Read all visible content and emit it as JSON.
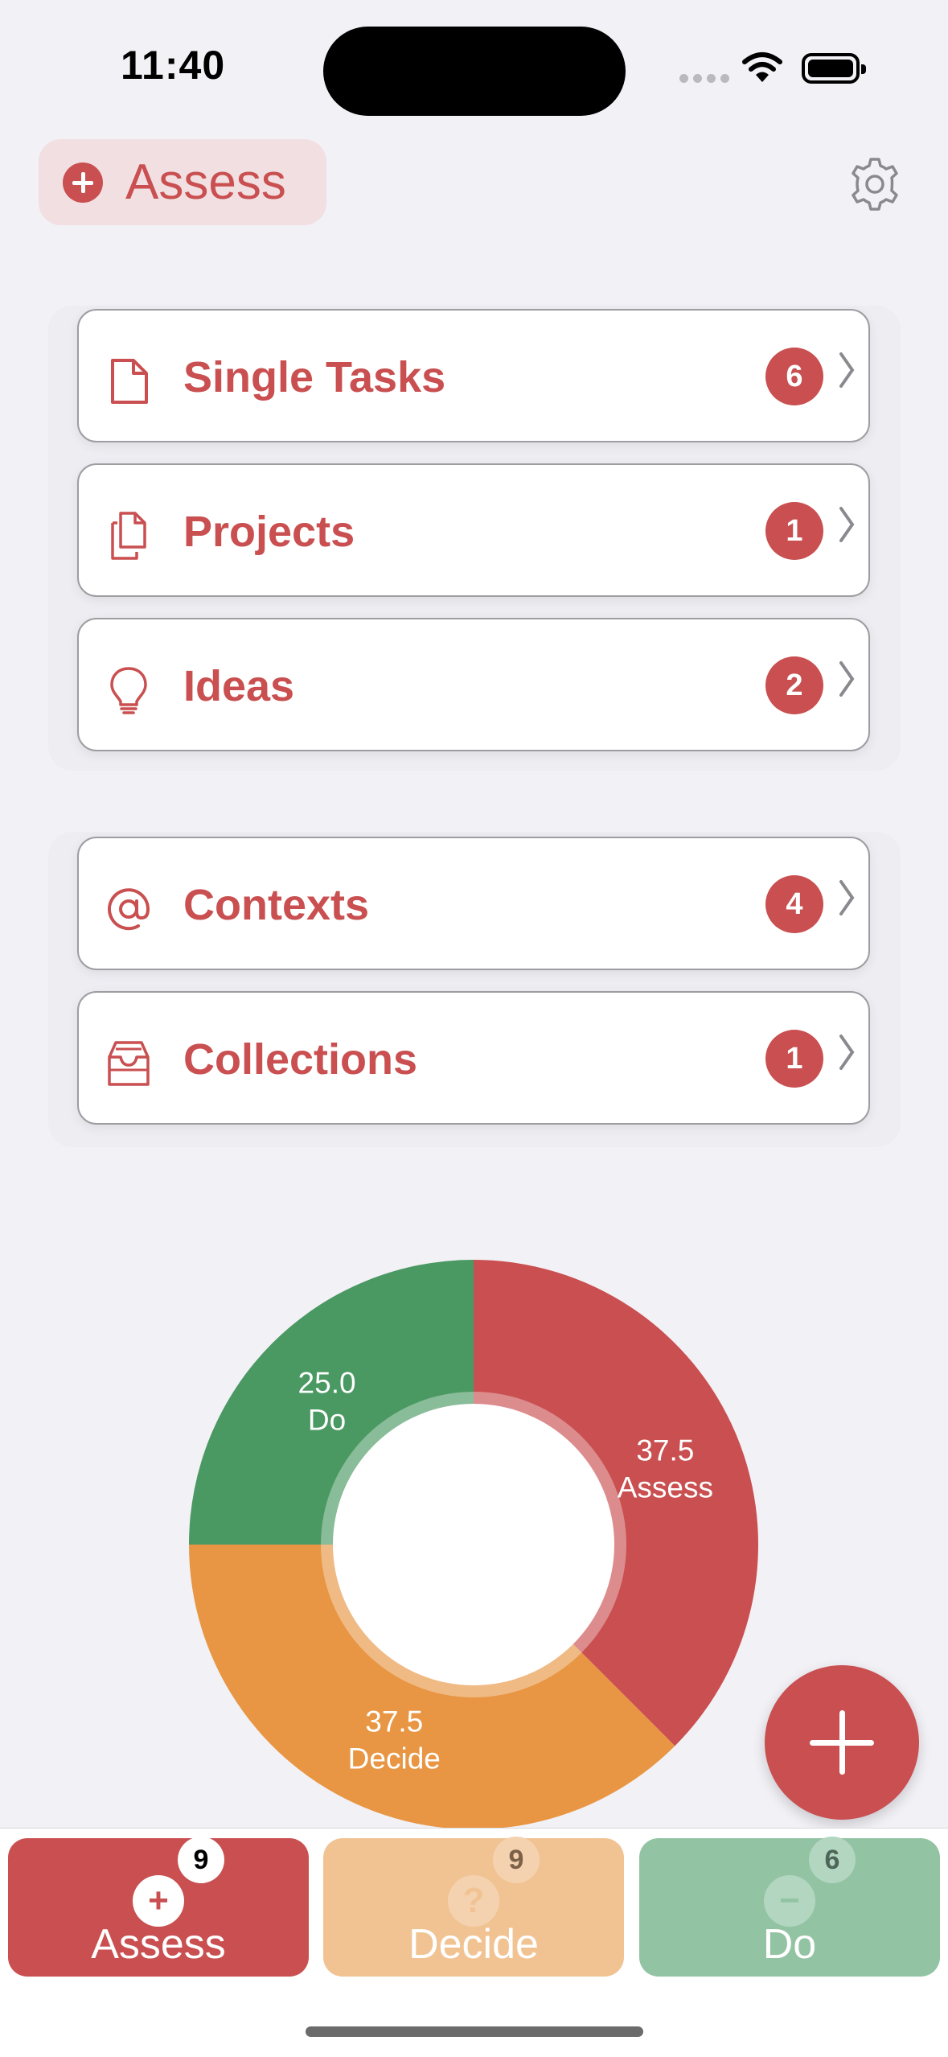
{
  "status_bar": {
    "time": "11:40"
  },
  "header": {
    "filter_label": "Assess",
    "settings_icon": "gear-icon"
  },
  "lists_group_1": [
    {
      "label": "Single Tasks",
      "count": "6",
      "icon": "document-icon"
    },
    {
      "label": "Projects",
      "count": "1",
      "icon": "documents-icon"
    },
    {
      "label": "Ideas",
      "count": "2",
      "icon": "lightbulb-icon"
    }
  ],
  "lists_group_2": [
    {
      "label": "Contexts",
      "count": "4",
      "icon": "at-icon"
    },
    {
      "label": "Collections",
      "count": "1",
      "icon": "tray-icon"
    }
  ],
  "chart_data": {
    "type": "pie",
    "style": "donut",
    "slices": [
      {
        "label": "Assess",
        "value": 37.5,
        "value_text": "37.5",
        "color": "#c94f50"
      },
      {
        "label": "Decide",
        "value": 37.5,
        "value_text": "37.5",
        "color": "#e89643"
      },
      {
        "label": "Do",
        "value": 25.0,
        "value_text": "25.0",
        "color": "#4a9862"
      }
    ]
  },
  "tabs": [
    {
      "label": "Assess",
      "badge": "9",
      "icon": "plus-circle-icon",
      "glyph": "+"
    },
    {
      "label": "Decide",
      "badge": "9",
      "icon": "question-circle-icon",
      "glyph": "?"
    },
    {
      "label": "Do",
      "badge": "6",
      "icon": "minus-circle-icon",
      "glyph": "−"
    }
  ],
  "colors": {
    "accent": "#c94f50",
    "decide": "#e89643",
    "do": "#4a9862",
    "background": "#f2f1f6"
  }
}
